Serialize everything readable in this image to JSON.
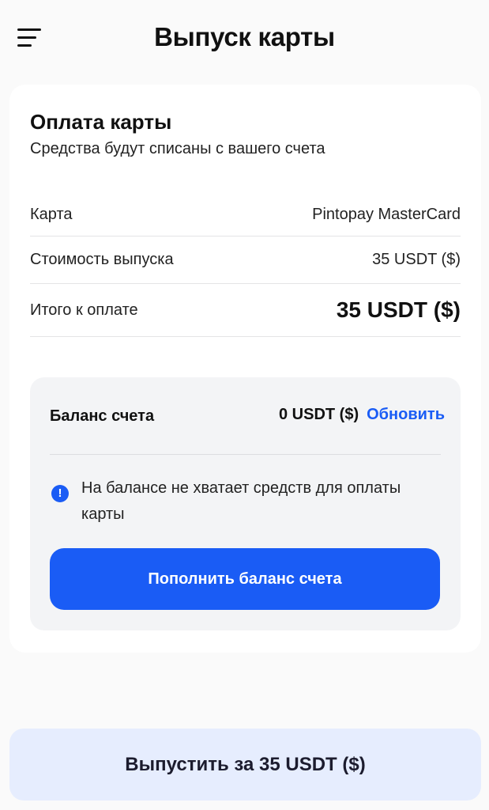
{
  "header": {
    "title": "Выпуск карты",
    "menu_icon": "hamburger-menu-icon"
  },
  "payment": {
    "title": "Оплата карты",
    "subtitle": "Средства будут списаны с вашего счета",
    "rows": {
      "card": {
        "label": "Карта",
        "value": "Pintopay MasterCard"
      },
      "cost": {
        "label": "Стоимость выпуска",
        "value": "35 USDT ($)"
      },
      "total": {
        "label": "Итого к оплате",
        "value": "35 USDT ($)"
      }
    }
  },
  "balance": {
    "label": "Баланс счета",
    "value": "0 USDT ($)",
    "refresh_label": "Обновить",
    "warning_icon": "exclamation-circle-icon",
    "warning_text": "На балансе не хватает средств для оплаты карты",
    "topup_label": "Пополнить баланс счета"
  },
  "footer": {
    "issue_label": "Выпустить за 35 USDT ($)"
  },
  "colors": {
    "accent": "#1a5cf5",
    "secondary_button_bg": "#e6edfe",
    "panel_bg": "#f3f4f6"
  }
}
